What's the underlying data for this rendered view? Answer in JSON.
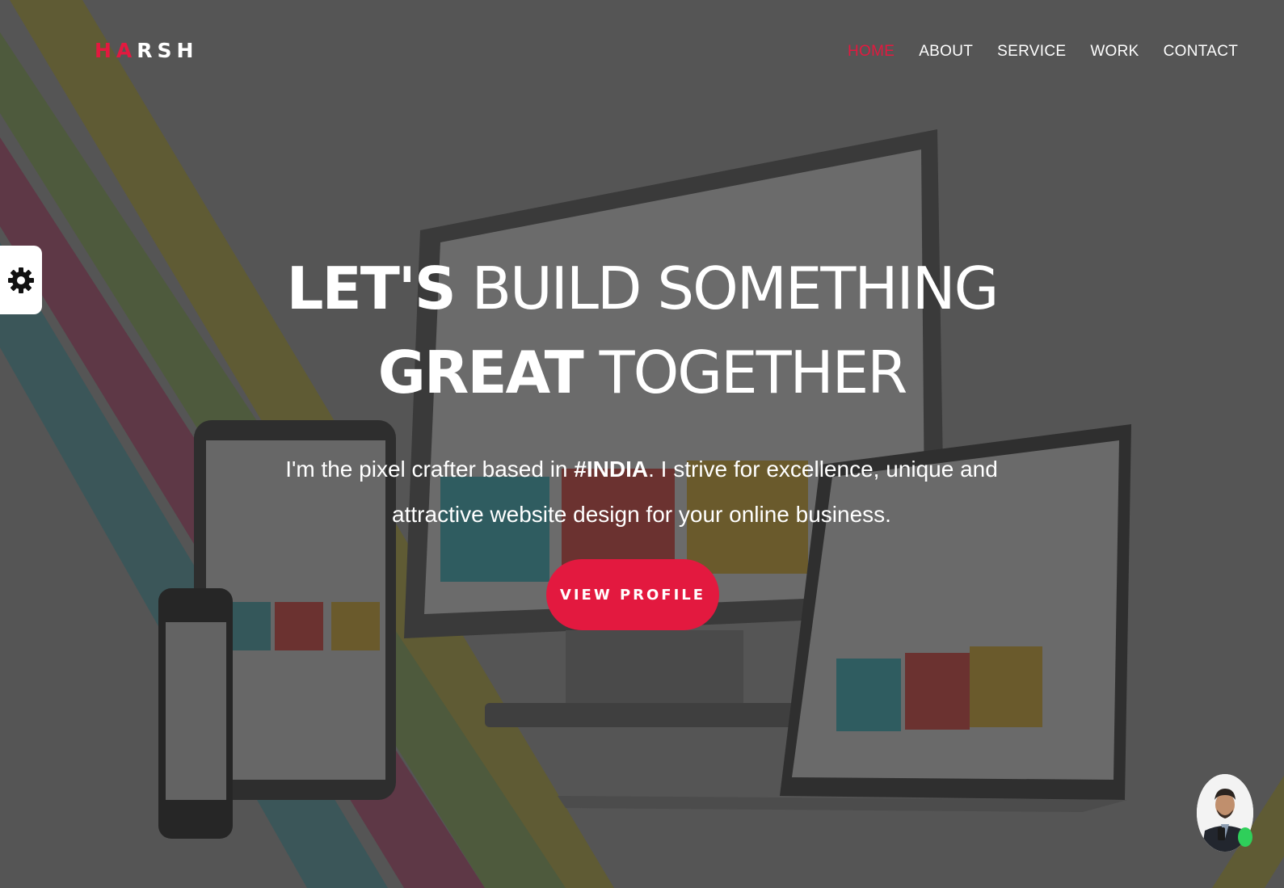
{
  "brand": {
    "logo_accent": "HA",
    "logo_rest": "RSH",
    "accent_color": "#e3193f"
  },
  "nav": {
    "items": [
      {
        "label": "HOME",
        "active": true
      },
      {
        "label": "ABOUT",
        "active": false
      },
      {
        "label": "SERVICE",
        "active": false
      },
      {
        "label": "WORK",
        "active": false
      },
      {
        "label": "CONTACT",
        "active": false
      }
    ]
  },
  "hero": {
    "line1_strong": "LET'S",
    "line1_light": " BUILD SOMETHING",
    "line2_strong": "GREAT",
    "line2_light": " TOGETHER",
    "text_before": "I'm the pixel crafter based in ",
    "text_bold": "#INDIA",
    "text_after": ". I strive for excellence, unique and attractive website design for your online business.",
    "cta_label": "VIEW PROFILE"
  },
  "icons": {
    "settings": "gear-icon",
    "avatar": "profile-photo",
    "status": "online-status-dot"
  },
  "colors": {
    "background": "#565656",
    "cta": "#e3193f",
    "online": "#2fcf5a"
  }
}
